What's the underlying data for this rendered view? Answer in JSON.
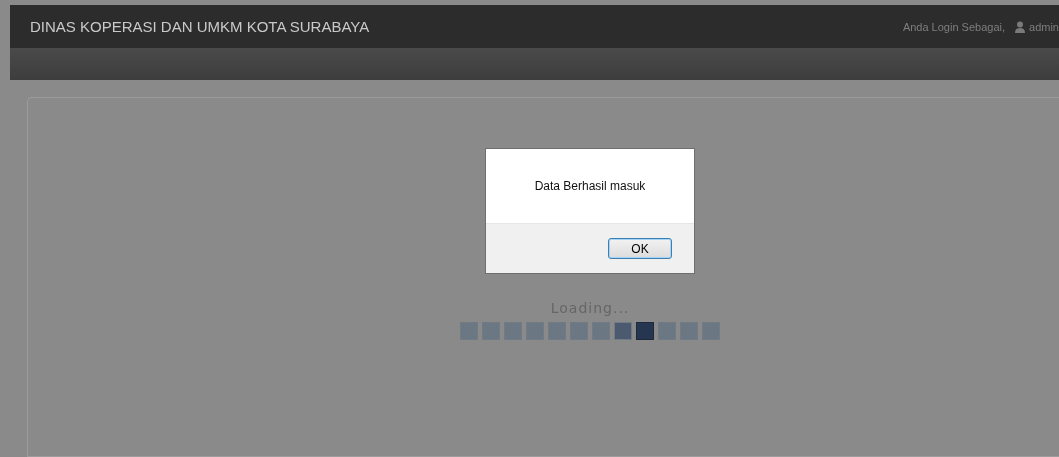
{
  "header": {
    "title": "DINAS KOPERASI DAN UMKM KOTA SURABAYA",
    "login_label": "Anda Login Sebagai,",
    "user": "admin"
  },
  "dialog": {
    "message": "Data Berhasil masuk",
    "button": "OK"
  },
  "loader": {
    "label": "Loading...",
    "segments": [
      {
        "kind": "idle"
      },
      {
        "kind": "idle"
      },
      {
        "kind": "idle"
      },
      {
        "kind": "idle"
      },
      {
        "kind": "idle"
      },
      {
        "kind": "idle"
      },
      {
        "kind": "idle"
      },
      {
        "kind": "trail"
      },
      {
        "kind": "active"
      },
      {
        "kind": "idle"
      },
      {
        "kind": "idle"
      },
      {
        "kind": "idle"
      }
    ]
  }
}
